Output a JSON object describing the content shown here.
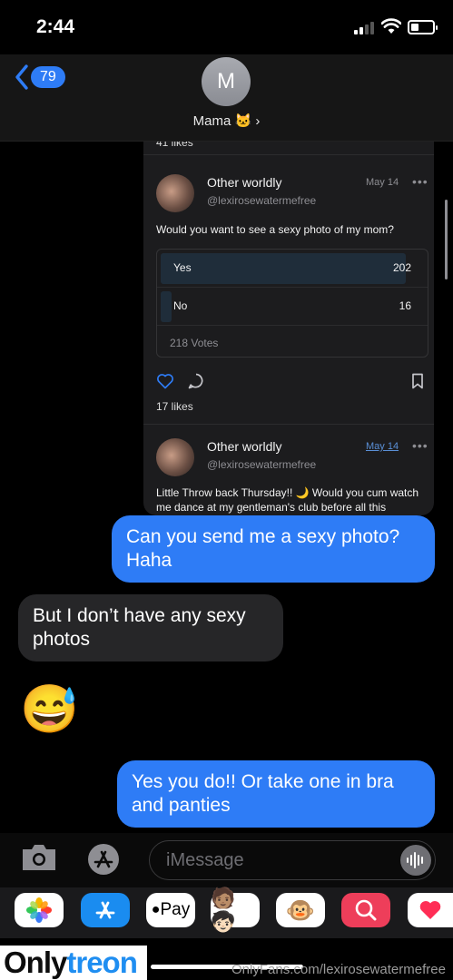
{
  "status_bar": {
    "time": "2:44"
  },
  "header": {
    "back_count": "79",
    "avatar_initial": "M",
    "contact_name": "Mama 🐱 ›"
  },
  "shared_post": {
    "likes_top": "41 likes",
    "post1": {
      "name": "Other worldly",
      "handle": "@lexirosewatermefree",
      "date": "May 14",
      "text": "Would you want to see a sexy photo of my mom?",
      "poll": [
        {
          "label": "Yes",
          "count": "202",
          "fraction": 0.93
        },
        {
          "label": "No",
          "count": "16",
          "fraction": 0.07
        }
      ],
      "votes": "218 Votes",
      "likes": "17 likes"
    },
    "post2": {
      "name": "Other worldly",
      "handle": "@lexirosewatermefree",
      "date": "May 14",
      "text": "Little Throw back Thursday!! 🌙 Would you cum watch me dance at my gentleman's club before all this"
    }
  },
  "messages": [
    {
      "direction": "outgoing",
      "text": "Can you send me a sexy photo? Haha"
    },
    {
      "direction": "incoming",
      "text": "But I don’t have any sexy photos"
    },
    {
      "direction": "incoming",
      "text": "😅"
    },
    {
      "direction": "outgoing",
      "text": "Yes you do!! Or take one in bra and panties"
    }
  ],
  "input_bar": {
    "placeholder": "iMessage"
  },
  "app_drawer": {
    "apple_pay_label": "Pay"
  },
  "footer": {
    "logo_only": "Only",
    "logo_treon": "treon",
    "watermark": "OnlyFans.com/lexirosewatermefree"
  },
  "colors": {
    "accent": "#2e7cf6",
    "incoming_bubble": "#262628",
    "card_bg": "#1c1c1e"
  }
}
